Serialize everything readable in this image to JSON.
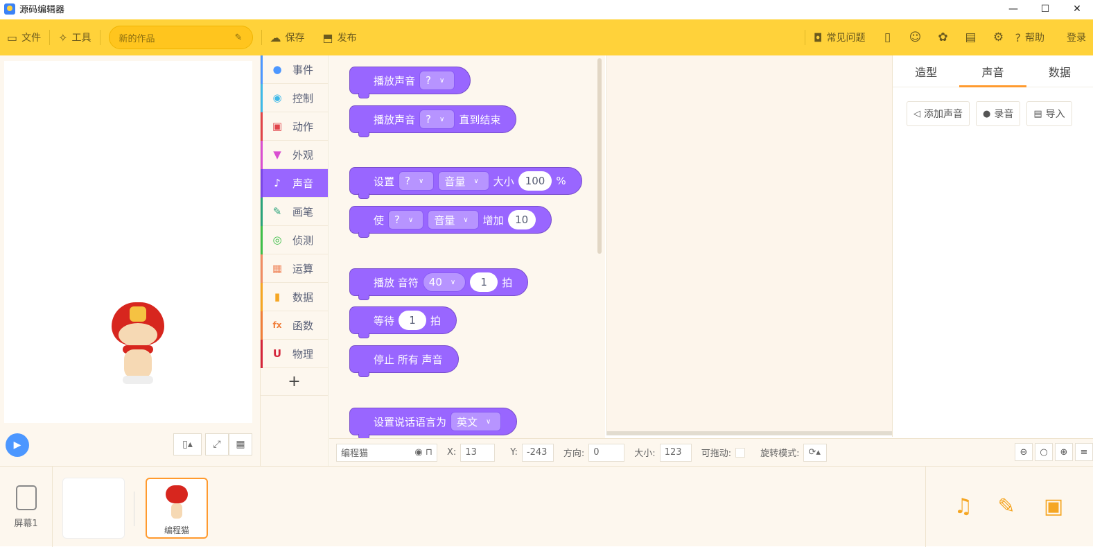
{
  "window": {
    "title": "源码编辑器",
    "min": "—",
    "max": "☐",
    "close": "✕"
  },
  "toolbar": {
    "file": "文件",
    "tools": "工具",
    "project_name": "新的作品",
    "edit_icon": "✎",
    "save": "保存",
    "publish": "发布",
    "faq": "常见问题",
    "help": "帮助",
    "login": "登录"
  },
  "categories": [
    {
      "label": "事件",
      "icon": "toggle-icon",
      "color": "#4c97ff",
      "glyph": "●"
    },
    {
      "label": "控制",
      "icon": "gamepad-icon",
      "color": "#3fb9e8",
      "glyph": "◉"
    },
    {
      "label": "动作",
      "icon": "ghost-icon",
      "color": "#e0444a",
      "glyph": "▣"
    },
    {
      "label": "外观",
      "icon": "shirt-icon",
      "color": "#d94fd1",
      "glyph": "▼"
    },
    {
      "label": "声音",
      "icon": "microphone-icon",
      "color": "#9966ff",
      "glyph": "♪"
    },
    {
      "label": "画笔",
      "icon": "pen-icon",
      "color": "#29a37a",
      "glyph": "✎"
    },
    {
      "label": "侦测",
      "icon": "radar-icon",
      "color": "#3fbf4a",
      "glyph": "◎"
    },
    {
      "label": "运算",
      "icon": "calc-icon",
      "color": "#f08c63",
      "glyph": "▦"
    },
    {
      "label": "数据",
      "icon": "bar-chart-icon",
      "color": "#f5a623",
      "glyph": "▮"
    },
    {
      "label": "函数",
      "icon": "function-icon",
      "color": "#f07e3a",
      "glyph": "fx"
    },
    {
      "label": "物理",
      "icon": "magnet-icon",
      "color": "#d4253b",
      "glyph": "U"
    }
  ],
  "add_category": "+",
  "blocks": {
    "play_sound": "播放声音",
    "q": "?",
    "until_done": "直到结束",
    "set": "设置",
    "volume": "音量",
    "size": "大小",
    "val100": "100",
    "percent": "%",
    "make": "使",
    "increase": "增加",
    "val10": "10",
    "play_note": "播放 音符",
    "note": "40",
    "one": "1",
    "beat": "拍",
    "wait": "等待",
    "stop_all": "停止 所有 声音",
    "set_lang": "设置说话语言为",
    "english": "英文"
  },
  "right_panel": {
    "tabs": [
      "造型",
      "声音",
      "数据"
    ],
    "add_sound": "添加声音",
    "record": "录音",
    "import": "导入"
  },
  "props": {
    "sprite_name": "编程猫",
    "x_label": "X:",
    "x": "13",
    "y_label": "Y:",
    "y": "-243",
    "dir_label": "方向:",
    "dir": "0",
    "size_label": "大小:",
    "size": "123",
    "drag_label": "可拖动:",
    "rot_label": "旋转模式:"
  },
  "sprites": {
    "screen": "屏幕1",
    "sprite1": "编程猫"
  }
}
